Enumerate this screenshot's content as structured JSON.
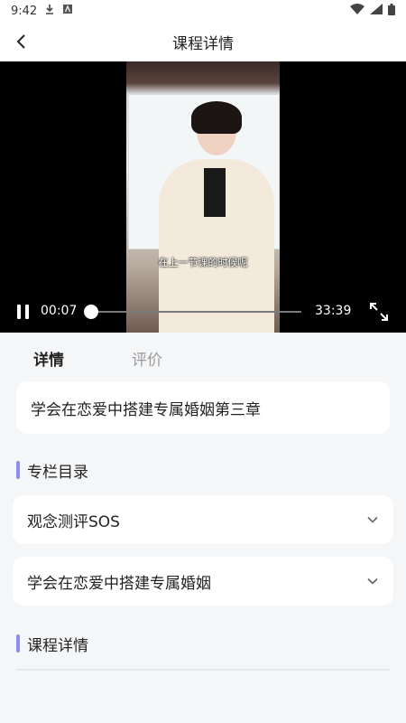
{
  "status_bar": {
    "time": "9:42"
  },
  "header": {
    "title": "课程详情"
  },
  "video": {
    "subtitle": "在上一节课的时候呢",
    "current_time": "00:07",
    "total_time": "33:39",
    "progress": 0.0035
  },
  "tabs": [
    {
      "label": "详情"
    },
    {
      "label": "评价"
    }
  ],
  "course": {
    "title": "学会在恋爱中搭建专属婚姻第三章"
  },
  "catalog": {
    "heading": "专栏目录",
    "items": [
      {
        "label": "观念测评SOS"
      },
      {
        "label": "学会在恋爱中搭建专属婚姻"
      }
    ]
  },
  "details": {
    "heading": "课程详情"
  },
  "colors": {
    "accent": "#8a8ef0",
    "background": "#f5f6f8"
  }
}
